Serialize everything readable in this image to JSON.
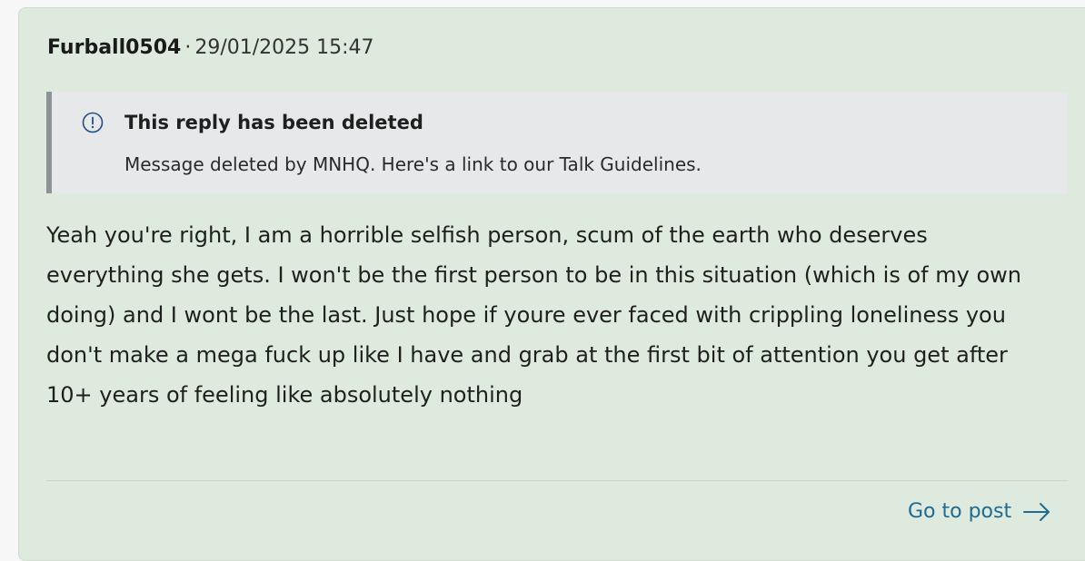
{
  "post": {
    "author": "Furball0504",
    "separator": "·",
    "timestamp": "29/01/2025 15:47",
    "deleted_notice": {
      "title": "This reply has been deleted",
      "message": "Message deleted by MNHQ. Here's a link to our Talk Guidelines.",
      "icon": "info-circle-icon"
    },
    "body": "Yeah you're right, I am a horrible selfish person, scum of the earth who deserves everything she gets. I won't be the first person to be in this situation (which is of my own doing) and I wont be the last. Just hope if youre ever faced with crippling loneliness you don't make a mega fuck up like I have and grab at the first bit of attention you get after 10+ years of feeling like absolutely nothing",
    "go_to_post_label": "Go to post",
    "go_icon": "arrow-right-icon"
  },
  "colors": {
    "card_bg": "#deeadd",
    "notice_bg": "#e6e8e9",
    "notice_border": "#8f9396",
    "link": "#1f6b92"
  }
}
